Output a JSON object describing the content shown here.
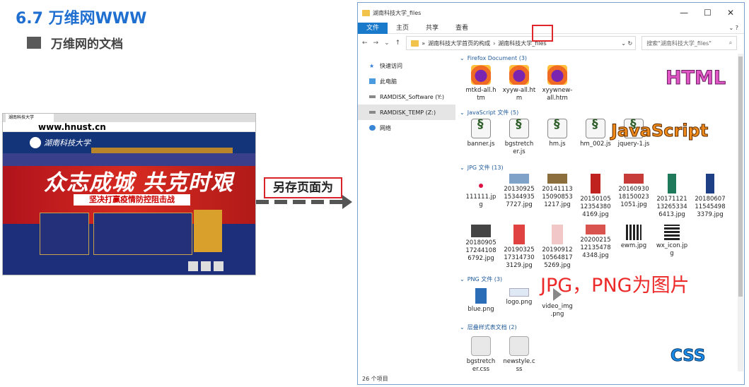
{
  "slide": {
    "title": "6.7 万维网WWW",
    "subtitle": "万维网的文档"
  },
  "browser": {
    "tab": "湖南科技大学",
    "url": "www.hnust.cn",
    "logo_text": "湖南科技大学",
    "slogan": "众志成城 共克时艰",
    "slogan2": "坚决打赢疫情防控阻击战"
  },
  "arrow": {
    "label": "另存页面为"
  },
  "explorer": {
    "title": "湖南科技大学_files",
    "ribbon": [
      "文件",
      "主页",
      "共享",
      "查看"
    ],
    "breadcrumb": [
      "湖南科技大学首页的构成",
      "湖南科技大学_files"
    ],
    "search_placeholder": "搜索\"湖南科技大学_files\"",
    "nav": [
      "快速访问",
      "此电脑",
      "RAMDISK_Software (Y:)",
      "RAMDISK_TEMP (Z:)",
      "网络"
    ],
    "groups": {
      "firefox": "Firefox Document (3)",
      "js": "JavaScript 文件 (5)",
      "jpg": "JPG 文件 (13)",
      "png": "PNG 文件 (3)",
      "css": "层叠样式表文档 (2)"
    },
    "files": {
      "ff": [
        "mtkd-all.h\ntm",
        "xyyw-all.ht\nm",
        "xyywnew-\nall.htm"
      ],
      "js": [
        "banner.js",
        "bgstretch\ner.js",
        "hm.js",
        "hm_002.js",
        "jquery-1.js"
      ],
      "jpg": [
        "111111.jp\ng",
        "20130925\n15344935\n7727.jpg",
        "20141113\n15090853\n1217.jpg",
        "20150105\n12354380\n4169.jpg",
        "20160930\n18150023\n1051.jpg",
        "20171121\n13265334\n6413.jpg",
        "20180607\n11545498\n3379.jpg",
        "20180905\n17244108\n6792.jpg",
        "20190325\n17314730\n3129.jpg",
        "20190912\n10564817\n5269.jpg",
        "20200215\n12135478\n4348.jpg",
        "ewm.jpg",
        "wx_icon.jp\ng"
      ],
      "png": [
        "blue.png",
        "logo.png",
        "video_img\n.png"
      ],
      "css": [
        "bgstretch\ner.css",
        "newstyle.c\nss"
      ]
    },
    "status": "26 个项目"
  },
  "annotations": {
    "html": "HTML",
    "js": "JavaScript",
    "jpg": "JPG，PNG为图片",
    "css": "CSS"
  },
  "colors": {
    "accent_blue": "#1f6fd1",
    "highlight_red": "#e0252b"
  }
}
